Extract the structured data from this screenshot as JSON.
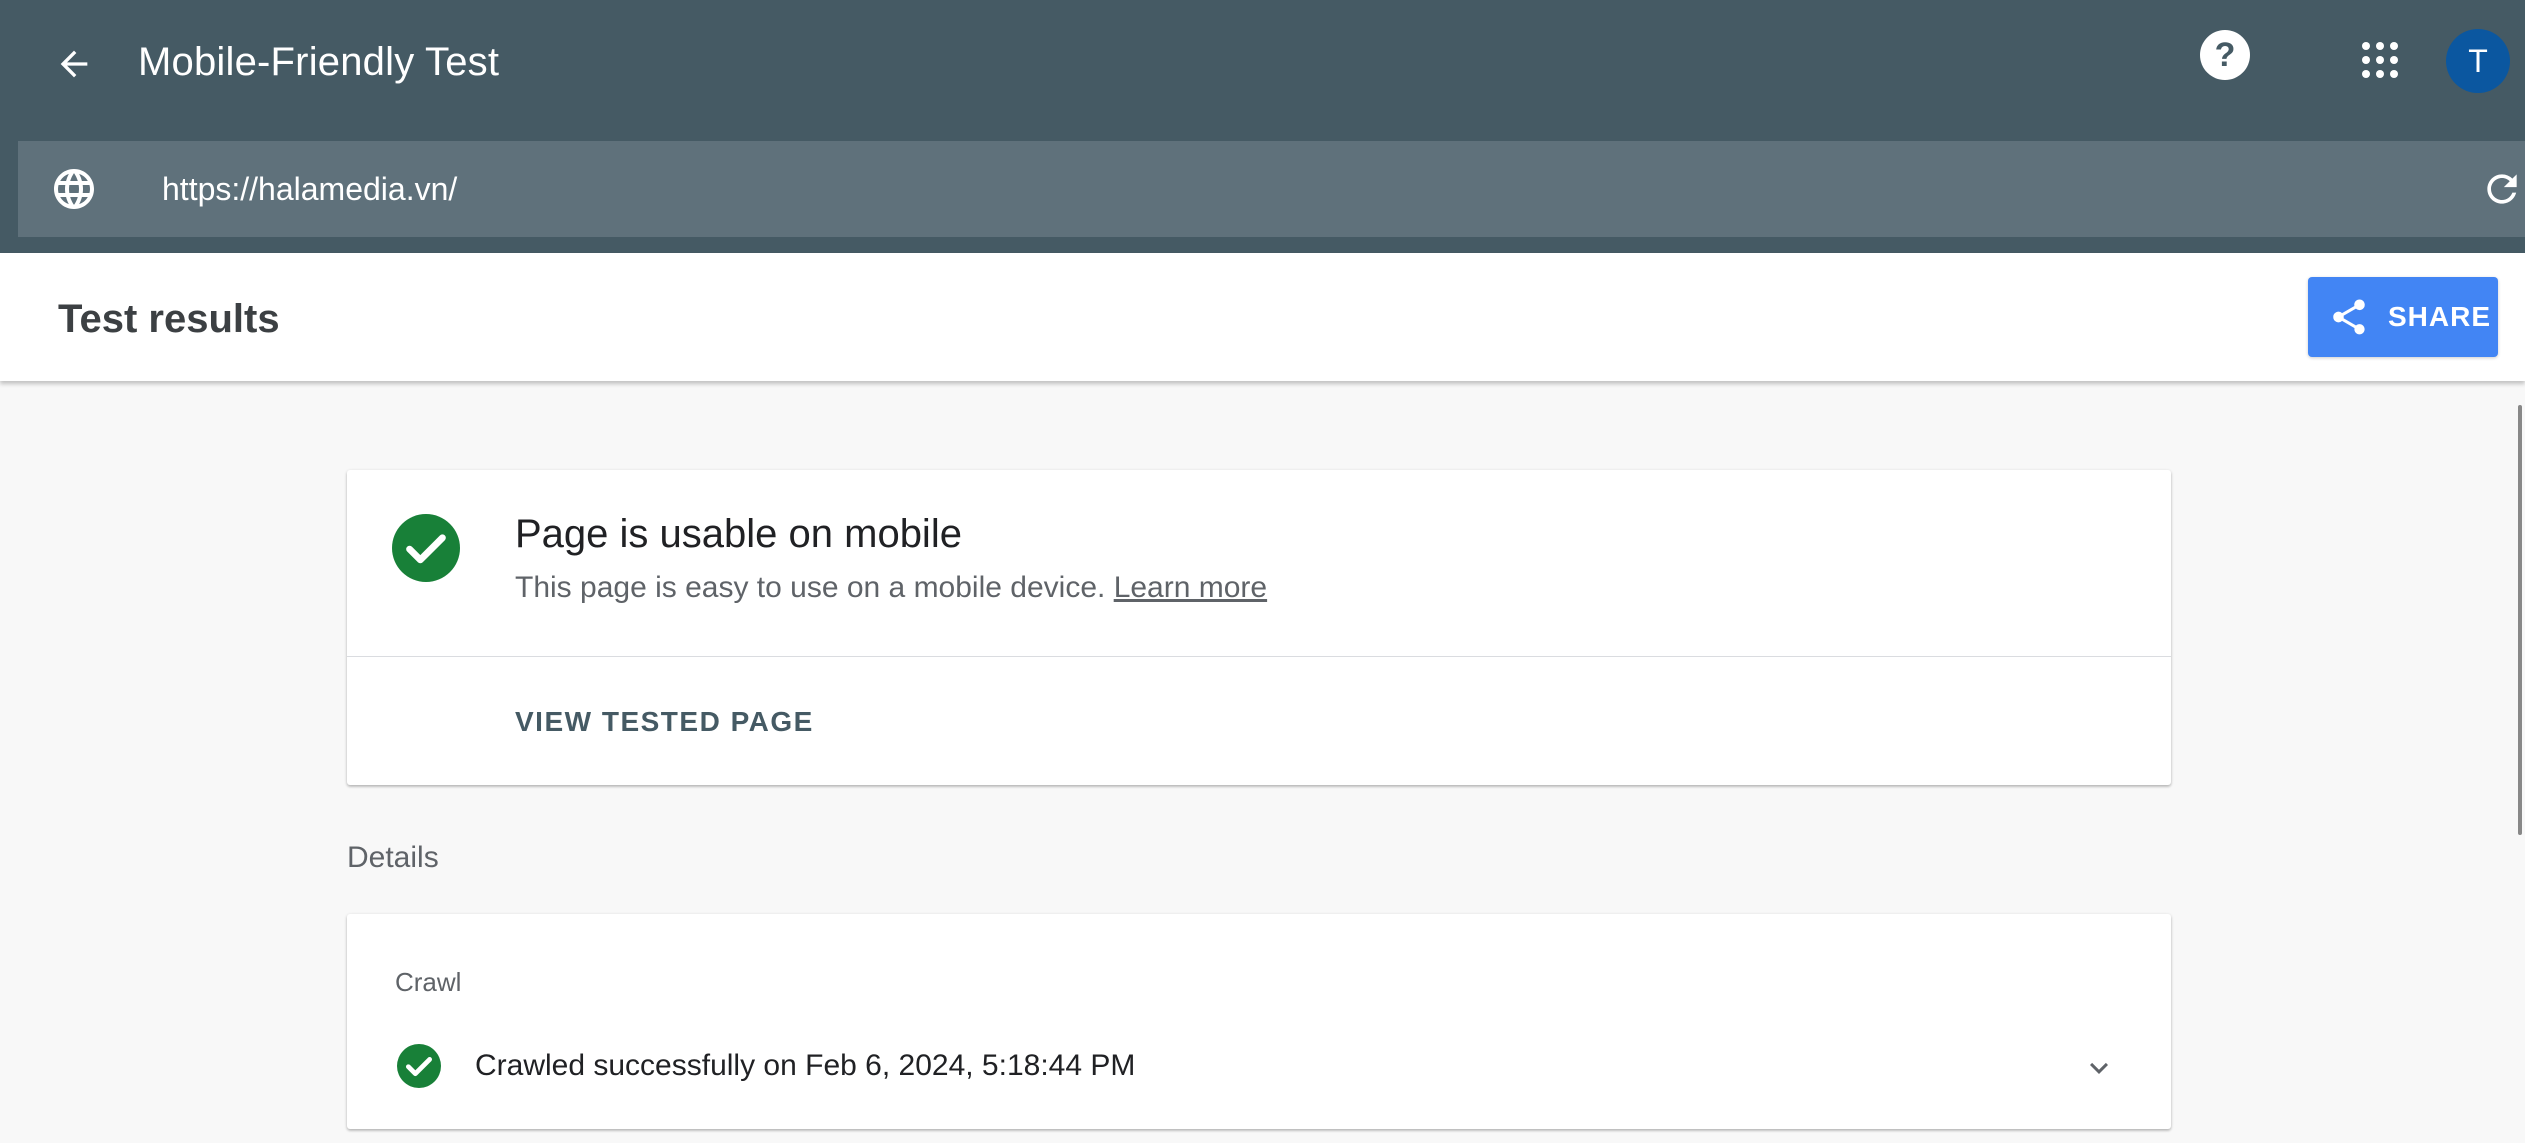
{
  "app_bar": {
    "title": "Mobile-Friendly Test",
    "help_glyph": "?",
    "avatar_initial": "T",
    "color": "#455a64",
    "icons": [
      "arrow-back-icon",
      "help-icon",
      "apps-grid-icon"
    ]
  },
  "url_bar": {
    "value": "https://halamedia.vn/",
    "icons": [
      "globe-icon",
      "reload-icon"
    ],
    "color": "#5f717b"
  },
  "results": {
    "title": "Test results",
    "share_label": "SHARE",
    "share_icon": "share-icon",
    "share_color": "#4285f4"
  },
  "verdict": {
    "status_icon": "check-circle-icon",
    "status_color": "#188038",
    "title": "Page is usable on mobile",
    "subtitle": "This page is easy to use on a mobile device.",
    "learn_more": "Learn more",
    "view_tested_label": "VIEW TESTED PAGE"
  },
  "details": {
    "label": "Details",
    "crawl": {
      "label": "Crawl",
      "status_icon": "check-circle-icon",
      "status_text": "Crawled successfully on Feb 6, 2024, 5:18:44 PM",
      "expand_icon": "chevron-down-icon"
    }
  }
}
